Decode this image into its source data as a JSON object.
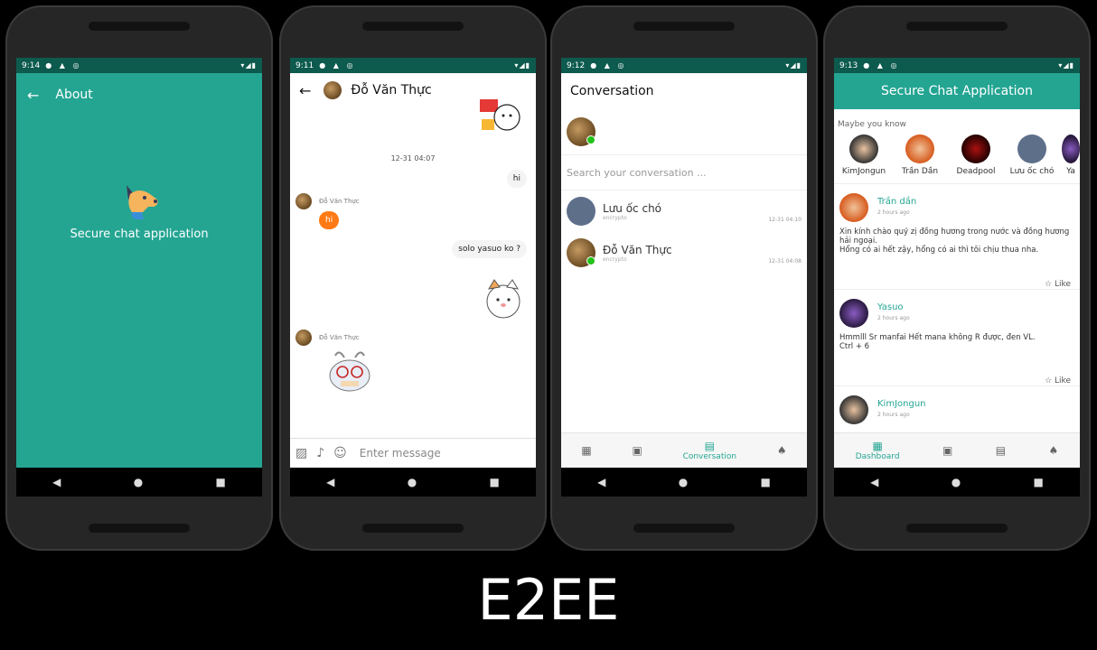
{
  "screens": {
    "about": {
      "time": "9:14",
      "title": "About",
      "tagline": "Secure chat application"
    },
    "chat": {
      "time": "9:11",
      "contact": "Đỗ Văn Thực",
      "timestamp": "12-31 04:07",
      "messages": [
        {
          "text": "hi"
        },
        {
          "sender": "Đỗ Văn Thực",
          "text": "hi"
        },
        {
          "text": "solo yasuo ko ?"
        },
        {
          "sender": "Đỗ Văn Thực"
        }
      ],
      "composer_placeholder": "Enter message"
    },
    "conversation": {
      "time": "9:12",
      "title": "Conversation",
      "search_placeholder": "Search your conversation ...",
      "items": [
        {
          "name": "Lưu ốc chó",
          "sub": "encrypto",
          "time": "12-31 04:10"
        },
        {
          "name": "Đỗ Văn Thực",
          "sub": "encrypto",
          "time": "12-31 04:08"
        }
      ],
      "nav_active": "Conversation"
    },
    "dashboard": {
      "time": "9:13",
      "title": "Secure Chat Application",
      "maybe_you_know": "Maybe you know",
      "people": [
        "KimJongun",
        "Trần Dần",
        "Deadpool",
        "Lưu ốc chó",
        "Ya"
      ],
      "posts": [
        {
          "name": "Trần dần",
          "time": "2 hours ago",
          "text": "Xin kính chào quý zị đồng hương trong nước và đồng hương hải ngoại.\nHổng có ai hết zậy, hổng có ai thì tôi chịu thua nha.",
          "like": "Like"
        },
        {
          "name": "Yasuo",
          "time": "2 hours ago",
          "text": "Hmmlll Sr manfai Hết mana không R được, đen VL.\n Ctrl + 6",
          "like": "Like"
        },
        {
          "name": "KimJongun",
          "time": "2 hours ago"
        }
      ],
      "nav_active": "Dashboard"
    }
  },
  "footer_title": "E2EE",
  "colors": {
    "accent": "#24a592",
    "orange": "#ff7a14",
    "status": "#0d5a4e"
  }
}
